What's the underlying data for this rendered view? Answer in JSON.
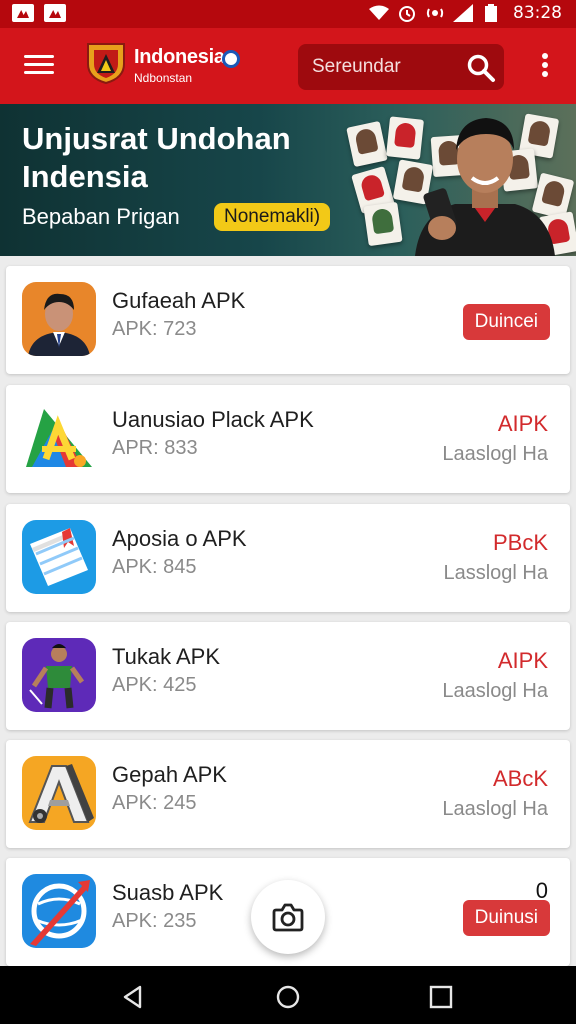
{
  "status_bar": {
    "time": "83:28"
  },
  "header": {
    "brand_title": "Indonesia",
    "brand_subtitle": "Ndbonstan",
    "search_placeholder": "Sereundar"
  },
  "banner": {
    "title": "Unjusrat Undohan Indensia",
    "subtitle": "Bepaban Prigan",
    "tag": "Nonemakli)"
  },
  "apps": [
    {
      "name": "Gufaeah APK",
      "meta": "APK: 723",
      "button": "Duincei"
    },
    {
      "name": "Uanusiao Plack APK",
      "meta": "APR: 833",
      "tag": "AIPK",
      "status": "Laaslogl Ha"
    },
    {
      "name": "Aposia o APK",
      "meta": "APK: 845",
      "tag": "PBcK",
      "status": "Lasslogl Ha"
    },
    {
      "name": "Tukak APK",
      "meta": "APK: 425",
      "tag": "AIPK",
      "status": "Laaslogl Ha"
    },
    {
      "name": "Gepah APK",
      "meta": "APK: 245",
      "tag": "ABcK",
      "status": "Laaslogl Ha"
    },
    {
      "name": "Suasb APK",
      "meta": "APK: 235",
      "count": "0",
      "button": "Duinusi"
    }
  ],
  "icons": {
    "menu": "hamburger-icon",
    "search": "search-icon",
    "more": "more-vert-icon",
    "fab": "camera-icon",
    "nav": [
      "back-icon",
      "home-icon",
      "recents-icon"
    ]
  },
  "colors": {
    "app_bar": "#d3151b",
    "status_bar": "#b5080d",
    "accent_button": "#d8393a",
    "tag_yellow": "#f2c917"
  }
}
